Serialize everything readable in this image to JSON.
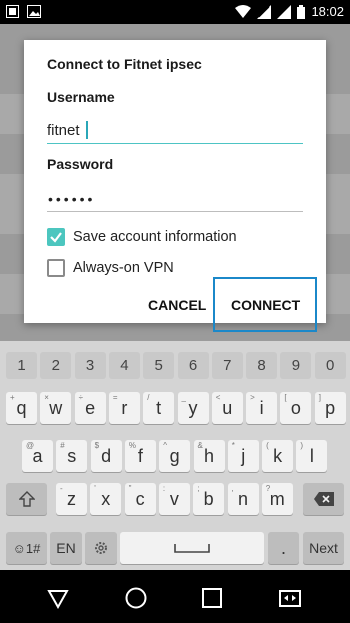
{
  "status": {
    "time": "18:02"
  },
  "dialog": {
    "title": "Connect to Fitnet ipsec",
    "username_label": "Username",
    "username_value": "fitnet",
    "password_label": "Password",
    "password_mask": "••••••",
    "save_label": "Save account information",
    "save_checked": true,
    "always_on_label": "Always-on VPN",
    "always_on_checked": false,
    "cancel_label": "CANCEL",
    "connect_label": "CONNECT"
  },
  "keyboard": {
    "numbers": [
      "1",
      "2",
      "3",
      "4",
      "5",
      "6",
      "7",
      "8",
      "9",
      "0"
    ],
    "row1": [
      {
        "k": "q",
        "h": "+"
      },
      {
        "k": "w",
        "h": "×"
      },
      {
        "k": "e",
        "h": "÷"
      },
      {
        "k": "r",
        "h": "="
      },
      {
        "k": "t",
        "h": "/"
      },
      {
        "k": "y",
        "h": "_"
      },
      {
        "k": "u",
        "h": "<"
      },
      {
        "k": "i",
        "h": ">"
      },
      {
        "k": "o",
        "h": "["
      },
      {
        "k": "p",
        "h": "]"
      }
    ],
    "row2": [
      {
        "k": "a",
        "h": "@"
      },
      {
        "k": "s",
        "h": "#"
      },
      {
        "k": "d",
        "h": "$"
      },
      {
        "k": "f",
        "h": "%"
      },
      {
        "k": "g",
        "h": "^"
      },
      {
        "k": "h",
        "h": "&"
      },
      {
        "k": "j",
        "h": "*"
      },
      {
        "k": "k",
        "h": "("
      },
      {
        "k": "l",
        "h": ")"
      }
    ],
    "row3": [
      {
        "k": "z",
        "h": "-"
      },
      {
        "k": "x",
        "h": "'"
      },
      {
        "k": "c",
        "h": "\""
      },
      {
        "k": "v",
        "h": ":"
      },
      {
        "k": "b",
        "h": ";"
      },
      {
        "k": "n",
        "h": ","
      },
      {
        "k": "m",
        "h": "?"
      }
    ],
    "sym_label": "☺1#",
    "lang_label": "EN",
    "period_label": ".",
    "next_label": "Next"
  }
}
